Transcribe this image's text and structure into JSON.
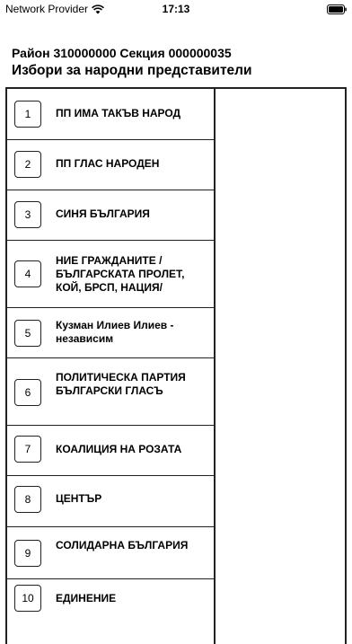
{
  "status_bar": {
    "carrier": "Network Provider",
    "time": "17:13"
  },
  "header": {
    "section_line": "Район 310000000 Секция 000000035",
    "election_title": "Избори за народни представители"
  },
  "parties": [
    {
      "number": "1",
      "name": "ПП ИМА ТАКЪВ НАРОД"
    },
    {
      "number": "2",
      "name": "ПП ГЛАС НАРОДЕН"
    },
    {
      "number": "3",
      "name": "СИНЯ БЪЛГАРИЯ"
    },
    {
      "number": "4",
      "name": "НИЕ ГРАЖДАНИТЕ / БЪЛГАРСКАТА ПРОЛЕТ, КОЙ, БРСП, НАЦИЯ/"
    },
    {
      "number": "5",
      "name": "Кузман Илиев Илиев - независим"
    },
    {
      "number": "6",
      "name": "ПОЛИТИЧЕСКА ПАРТИЯ БЪЛГАРСКИ ГЛАСЪ"
    },
    {
      "number": "7",
      "name": "КОАЛИЦИЯ НА РОЗАТА"
    },
    {
      "number": "8",
      "name": "ЦЕНТЪР"
    },
    {
      "number": "9",
      "name": "СОЛИДАРНА БЪЛГАРИЯ"
    },
    {
      "number": "10",
      "name": "ЕДИНЕНИЕ"
    }
  ]
}
